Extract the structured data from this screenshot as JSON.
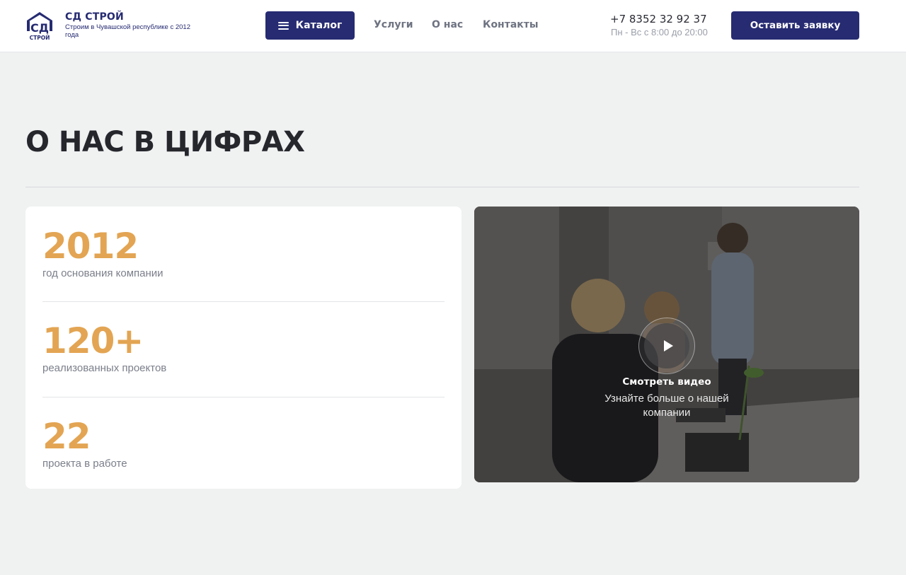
{
  "header": {
    "logo": {
      "letters": "СД",
      "sub": "СТРОЙ"
    },
    "brand_name": "СД СТРОЙ",
    "tagline": "Строим в Чувашской республике с 2012 года",
    "catalog_label": "Каталог",
    "nav": [
      {
        "label": "Услуги"
      },
      {
        "label": "О нас"
      },
      {
        "label": "Контакты"
      }
    ],
    "phone": "+7 8352 32 92 37",
    "hours": "Пн - Вс с 8:00 до 20:00",
    "request_label": "Оставить заявку"
  },
  "section": {
    "title": "О НАС В ЦИФРАХ",
    "stats": [
      {
        "value": "2012",
        "label": "год основания компании"
      },
      {
        "value": "120+",
        "label": "реализованных проектов"
      },
      {
        "value": "22",
        "label": "проекта в работе"
      }
    ],
    "video": {
      "title": "Смотреть видео",
      "subtitle": "Узнайте больше о нашей компании"
    }
  },
  "colors": {
    "brand": "#262b72",
    "accent": "#e3a553",
    "background": "#f0f1f1"
  },
  "icons": [
    "house-logo-icon",
    "burger-menu-icon",
    "play-icon"
  ]
}
